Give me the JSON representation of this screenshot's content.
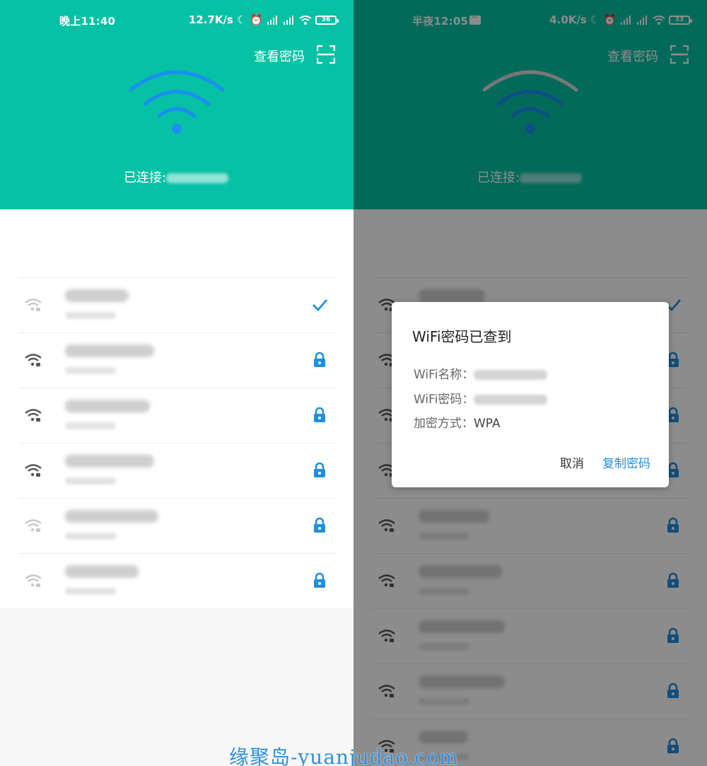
{
  "left_screen": {
    "status": {
      "time": "晚上11:40",
      "speed": "12.7K/s",
      "battery": "36"
    },
    "view_password_label": "查看密码",
    "connected_label": "已连接:",
    "networks": [
      {
        "name_width": 90,
        "icon": "wifi-locked-faint",
        "action": "check"
      },
      {
        "name_width": 126,
        "icon": "wifi-locked",
        "action": "lock"
      },
      {
        "name_width": 120,
        "icon": "wifi-locked",
        "action": "lock"
      },
      {
        "name_width": 126,
        "icon": "wifi-locked",
        "action": "lock"
      },
      {
        "name_width": 132,
        "icon": "wifi-locked-faint",
        "action": "lock"
      },
      {
        "name_width": 104,
        "icon": "wifi-locked-faint",
        "action": "lock"
      }
    ]
  },
  "right_screen": {
    "status": {
      "time": "半夜12:05",
      "speed": "4.0K/s",
      "battery": "33"
    },
    "view_password_label": "查看密码",
    "connected_label": "已连接:",
    "dialog": {
      "title": "WiFi密码已查到",
      "wifi_name_label": "WiFi名称：",
      "wifi_password_label": "WiFi密码：",
      "encryption_label": "加密方式：",
      "encryption_value": "WPA",
      "cancel_label": "取消",
      "copy_label": "复制密码"
    }
  },
  "watermark": "缘聚岛-yuanjudao.com",
  "colors": {
    "header": "#06c1a4",
    "accent_blue": "#1f8fe0",
    "wifi_blue": "#1a8ff0"
  }
}
